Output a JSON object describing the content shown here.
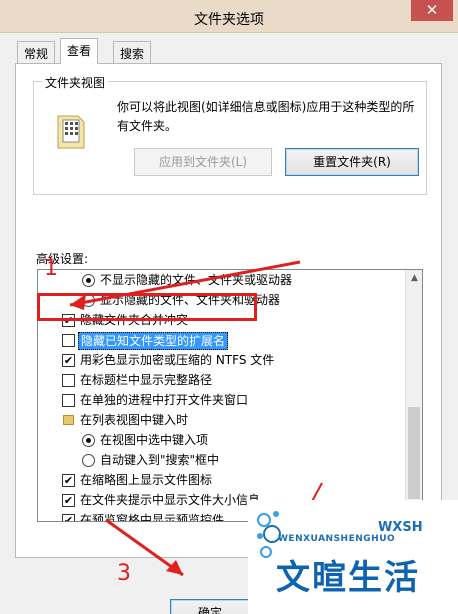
{
  "window": {
    "title": "文件夹选项",
    "close_label": "✕"
  },
  "tabs": [
    {
      "label": "常规",
      "active": false
    },
    {
      "label": "查看",
      "active": true
    },
    {
      "label": "搜索",
      "active": false
    }
  ],
  "folder_views": {
    "legend": "文件夹视图",
    "description": "你可以将此视图(如详细信息或图标)应用于这种类型的所有文件夹。",
    "apply_button": "应用到文件夹(L)",
    "reset_button": "重置文件夹(R)"
  },
  "advanced": {
    "label": "高级设置:",
    "items": [
      {
        "kind": "radio",
        "checked": true,
        "label": "不显示隐藏的文件、文件夹或驱动器"
      },
      {
        "kind": "radio",
        "checked": false,
        "label": "显示隐藏的文件、文件夹和驱动器"
      },
      {
        "kind": "checkbox",
        "checked": true,
        "label": "隐藏文件夹合并冲突"
      },
      {
        "kind": "checkbox",
        "checked": false,
        "label": "隐藏已知文件类型的扩展名",
        "selected": true
      },
      {
        "kind": "checkbox",
        "checked": true,
        "label": "用彩色显示加密或压缩的 NTFS 文件"
      },
      {
        "kind": "checkbox",
        "checked": false,
        "label": "在标题栏中显示完整路径"
      },
      {
        "kind": "checkbox",
        "checked": false,
        "label": "在单独的进程中打开文件夹窗口"
      },
      {
        "kind": "folder",
        "checked": false,
        "label": "在列表视图中键入时"
      },
      {
        "kind": "radio",
        "checked": true,
        "label": "在视图中选中键入项"
      },
      {
        "kind": "radio",
        "checked": false,
        "label": "自动键入到\"搜索\"框中"
      },
      {
        "kind": "checkbox",
        "checked": true,
        "label": "在缩略图上显示文件图标"
      },
      {
        "kind": "checkbox",
        "checked": true,
        "label": "在文件夹提示中显示文件大小信息"
      },
      {
        "kind": "checkbox",
        "checked": true,
        "label": "在预览窗格中显示预览控件"
      }
    ]
  },
  "footer": {
    "ok_button": "确定"
  },
  "annotations": {
    "step1": "1",
    "step3": "3",
    "color": "#e02020"
  },
  "watermark": {
    "top": "WXSH",
    "sub": "WENXUANSHENGHUO",
    "big": "文暄生活"
  }
}
